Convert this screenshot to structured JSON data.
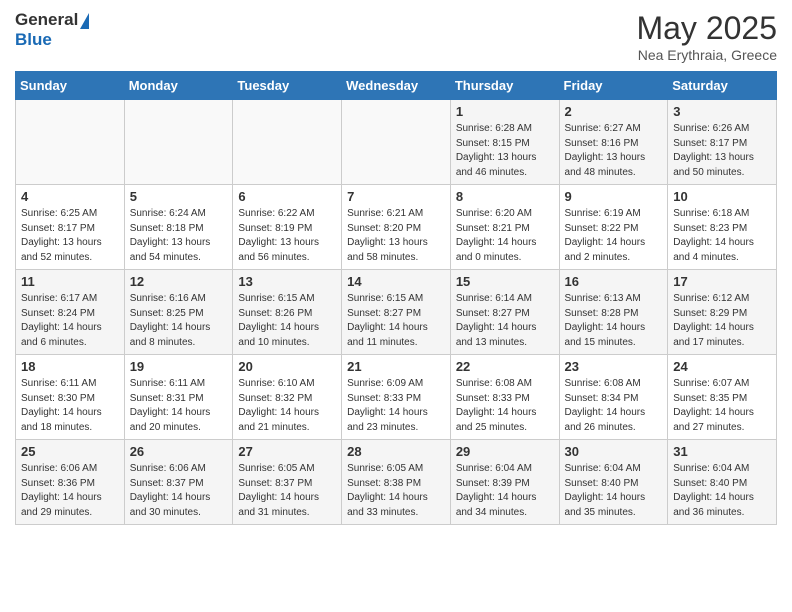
{
  "header": {
    "logo_general": "General",
    "logo_blue": "Blue",
    "month_title": "May 2025",
    "location": "Nea Erythraia, Greece"
  },
  "days_of_week": [
    "Sunday",
    "Monday",
    "Tuesday",
    "Wednesday",
    "Thursday",
    "Friday",
    "Saturday"
  ],
  "weeks": [
    {
      "cells": [
        {
          "day": "",
          "info": ""
        },
        {
          "day": "",
          "info": ""
        },
        {
          "day": "",
          "info": ""
        },
        {
          "day": "",
          "info": ""
        },
        {
          "day": "1",
          "info": "Sunrise: 6:28 AM\nSunset: 8:15 PM\nDaylight: 13 hours\nand 46 minutes."
        },
        {
          "day": "2",
          "info": "Sunrise: 6:27 AM\nSunset: 8:16 PM\nDaylight: 13 hours\nand 48 minutes."
        },
        {
          "day": "3",
          "info": "Sunrise: 6:26 AM\nSunset: 8:17 PM\nDaylight: 13 hours\nand 50 minutes."
        }
      ]
    },
    {
      "cells": [
        {
          "day": "4",
          "info": "Sunrise: 6:25 AM\nSunset: 8:17 PM\nDaylight: 13 hours\nand 52 minutes."
        },
        {
          "day": "5",
          "info": "Sunrise: 6:24 AM\nSunset: 8:18 PM\nDaylight: 13 hours\nand 54 minutes."
        },
        {
          "day": "6",
          "info": "Sunrise: 6:22 AM\nSunset: 8:19 PM\nDaylight: 13 hours\nand 56 minutes."
        },
        {
          "day": "7",
          "info": "Sunrise: 6:21 AM\nSunset: 8:20 PM\nDaylight: 13 hours\nand 58 minutes."
        },
        {
          "day": "8",
          "info": "Sunrise: 6:20 AM\nSunset: 8:21 PM\nDaylight: 14 hours\nand 0 minutes."
        },
        {
          "day": "9",
          "info": "Sunrise: 6:19 AM\nSunset: 8:22 PM\nDaylight: 14 hours\nand 2 minutes."
        },
        {
          "day": "10",
          "info": "Sunrise: 6:18 AM\nSunset: 8:23 PM\nDaylight: 14 hours\nand 4 minutes."
        }
      ]
    },
    {
      "cells": [
        {
          "day": "11",
          "info": "Sunrise: 6:17 AM\nSunset: 8:24 PM\nDaylight: 14 hours\nand 6 minutes."
        },
        {
          "day": "12",
          "info": "Sunrise: 6:16 AM\nSunset: 8:25 PM\nDaylight: 14 hours\nand 8 minutes."
        },
        {
          "day": "13",
          "info": "Sunrise: 6:15 AM\nSunset: 8:26 PM\nDaylight: 14 hours\nand 10 minutes."
        },
        {
          "day": "14",
          "info": "Sunrise: 6:15 AM\nSunset: 8:27 PM\nDaylight: 14 hours\nand 11 minutes."
        },
        {
          "day": "15",
          "info": "Sunrise: 6:14 AM\nSunset: 8:27 PM\nDaylight: 14 hours\nand 13 minutes."
        },
        {
          "day": "16",
          "info": "Sunrise: 6:13 AM\nSunset: 8:28 PM\nDaylight: 14 hours\nand 15 minutes."
        },
        {
          "day": "17",
          "info": "Sunrise: 6:12 AM\nSunset: 8:29 PM\nDaylight: 14 hours\nand 17 minutes."
        }
      ]
    },
    {
      "cells": [
        {
          "day": "18",
          "info": "Sunrise: 6:11 AM\nSunset: 8:30 PM\nDaylight: 14 hours\nand 18 minutes."
        },
        {
          "day": "19",
          "info": "Sunrise: 6:11 AM\nSunset: 8:31 PM\nDaylight: 14 hours\nand 20 minutes."
        },
        {
          "day": "20",
          "info": "Sunrise: 6:10 AM\nSunset: 8:32 PM\nDaylight: 14 hours\nand 21 minutes."
        },
        {
          "day": "21",
          "info": "Sunrise: 6:09 AM\nSunset: 8:33 PM\nDaylight: 14 hours\nand 23 minutes."
        },
        {
          "day": "22",
          "info": "Sunrise: 6:08 AM\nSunset: 8:33 PM\nDaylight: 14 hours\nand 25 minutes."
        },
        {
          "day": "23",
          "info": "Sunrise: 6:08 AM\nSunset: 8:34 PM\nDaylight: 14 hours\nand 26 minutes."
        },
        {
          "day": "24",
          "info": "Sunrise: 6:07 AM\nSunset: 8:35 PM\nDaylight: 14 hours\nand 27 minutes."
        }
      ]
    },
    {
      "cells": [
        {
          "day": "25",
          "info": "Sunrise: 6:06 AM\nSunset: 8:36 PM\nDaylight: 14 hours\nand 29 minutes."
        },
        {
          "day": "26",
          "info": "Sunrise: 6:06 AM\nSunset: 8:37 PM\nDaylight: 14 hours\nand 30 minutes."
        },
        {
          "day": "27",
          "info": "Sunrise: 6:05 AM\nSunset: 8:37 PM\nDaylight: 14 hours\nand 31 minutes."
        },
        {
          "day": "28",
          "info": "Sunrise: 6:05 AM\nSunset: 8:38 PM\nDaylight: 14 hours\nand 33 minutes."
        },
        {
          "day": "29",
          "info": "Sunrise: 6:04 AM\nSunset: 8:39 PM\nDaylight: 14 hours\nand 34 minutes."
        },
        {
          "day": "30",
          "info": "Sunrise: 6:04 AM\nSunset: 8:40 PM\nDaylight: 14 hours\nand 35 minutes."
        },
        {
          "day": "31",
          "info": "Sunrise: 6:04 AM\nSunset: 8:40 PM\nDaylight: 14 hours\nand 36 minutes."
        }
      ]
    }
  ]
}
